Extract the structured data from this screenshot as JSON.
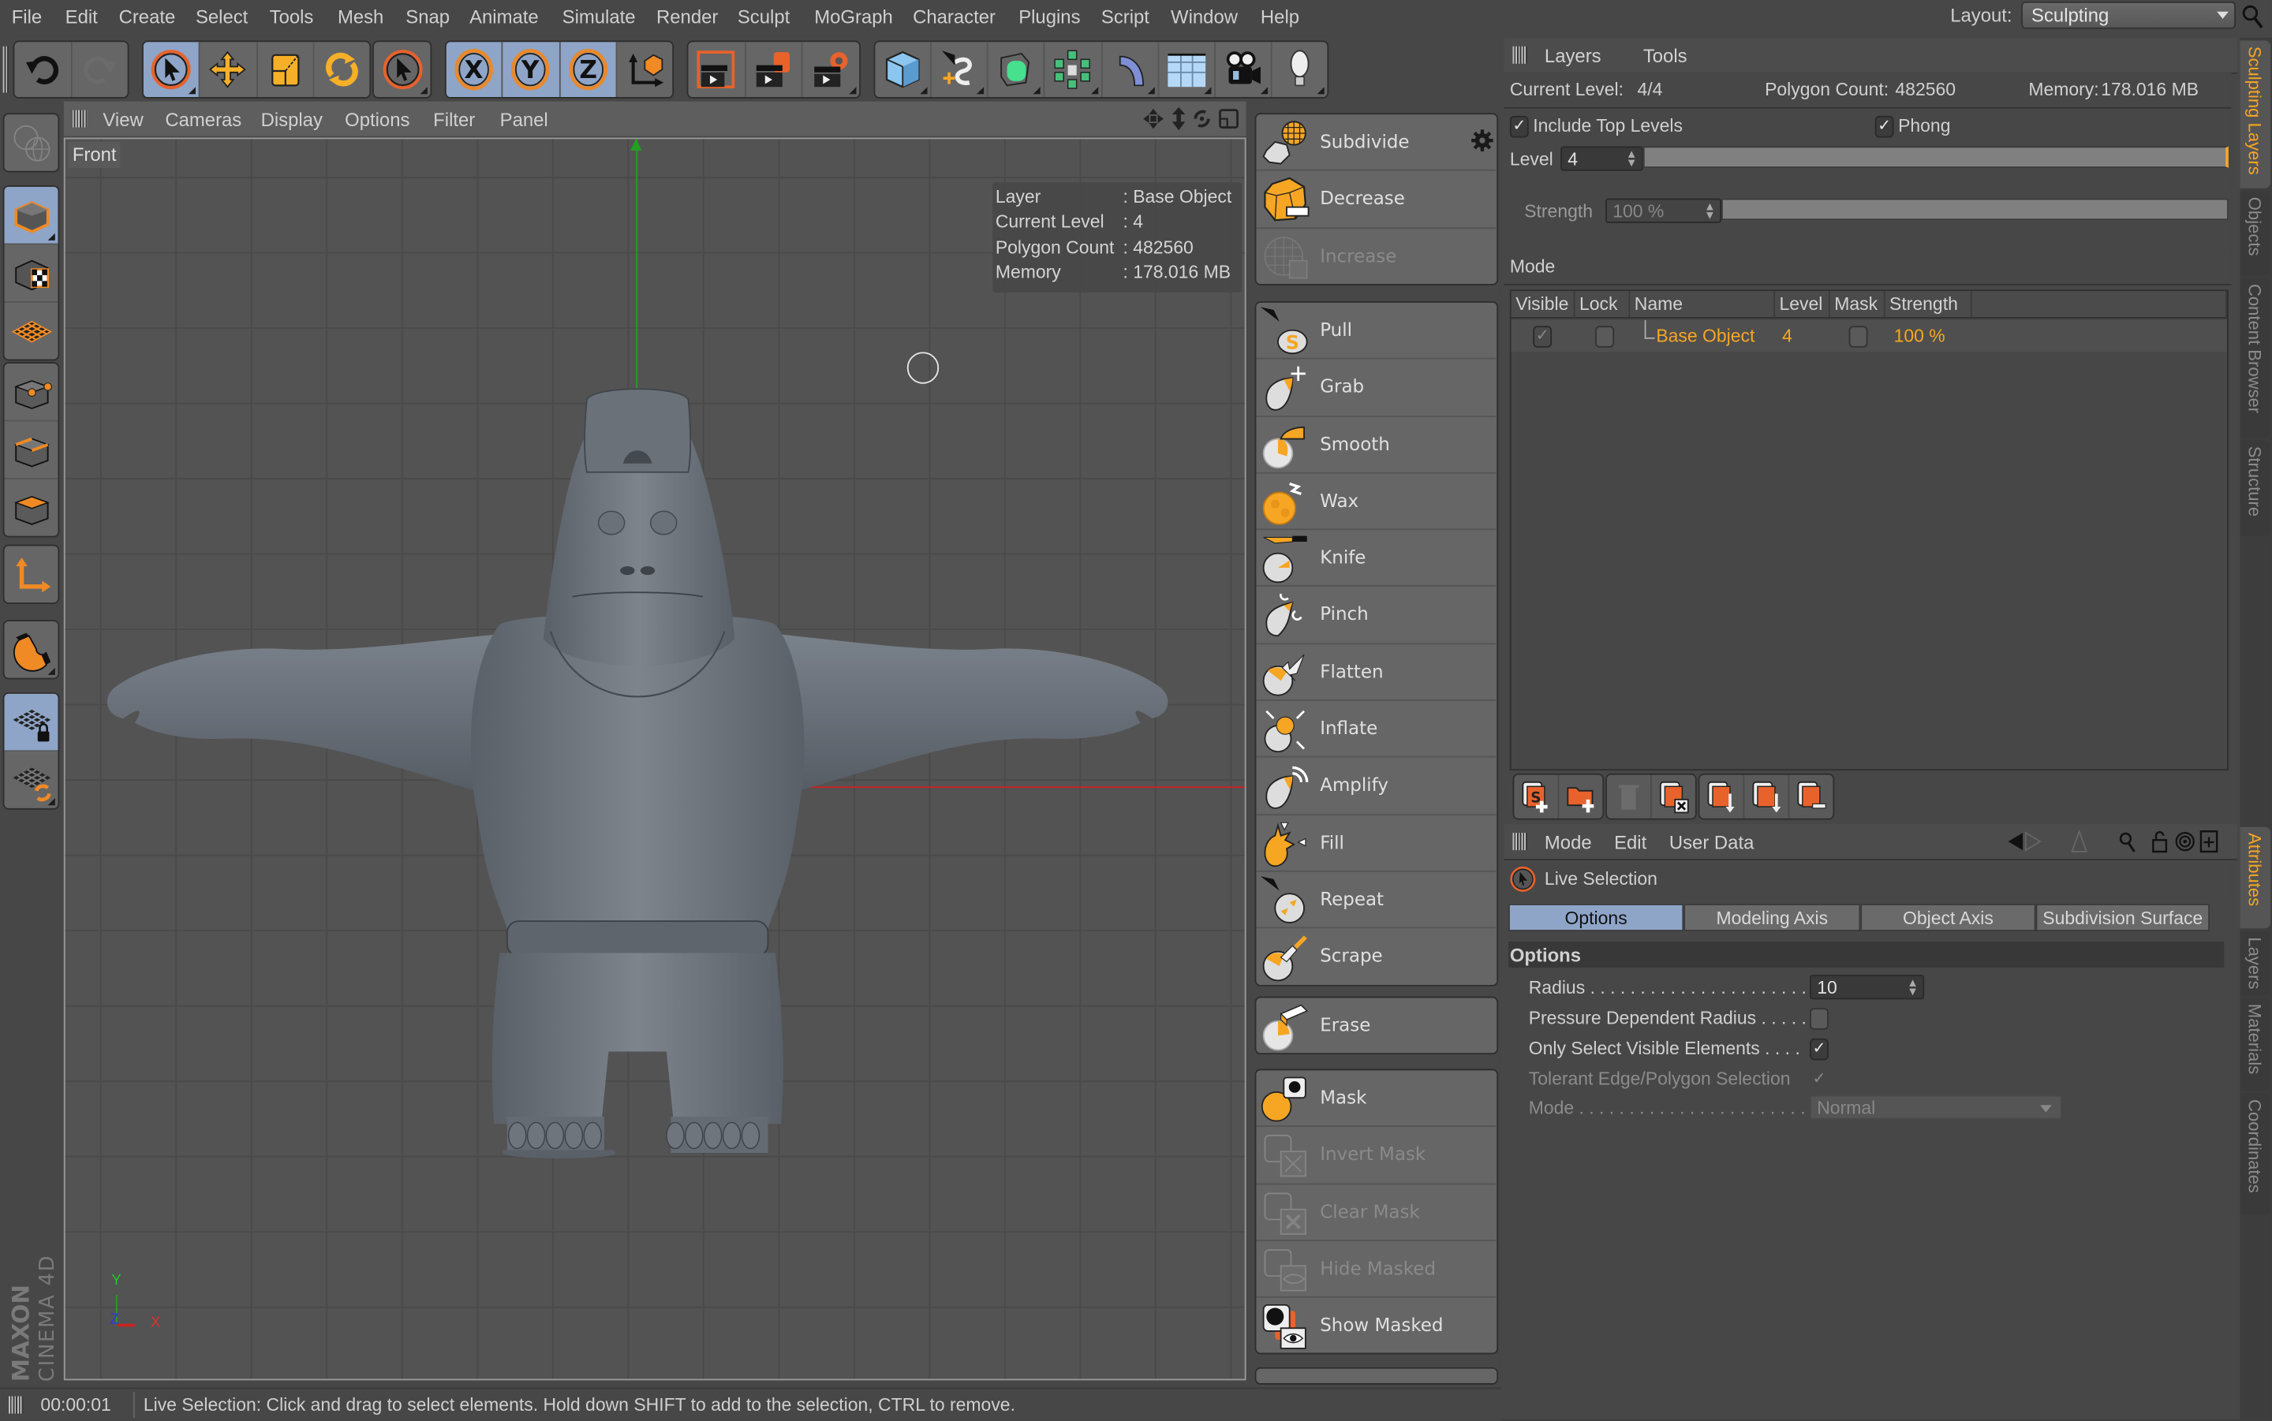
{
  "menubar": {
    "items": [
      "File",
      "Edit",
      "Create",
      "Select",
      "Tools",
      "Mesh",
      "Snap",
      "Animate",
      "Simulate",
      "Render",
      "Sculpt",
      "MoGraph",
      "Character",
      "Plugins",
      "Script",
      "Window",
      "Help"
    ],
    "layout_label": "Layout:",
    "layout_value": "Sculpting"
  },
  "toolbar": {
    "groups": [
      {
        "name": "history",
        "buttons": [
          {
            "icon": "undo-icon",
            "active": false
          },
          {
            "icon": "redo-icon",
            "active": false,
            "disabled": true
          }
        ]
      },
      {
        "name": "transform",
        "buttons": [
          {
            "icon": "live-selection-icon",
            "active": true
          },
          {
            "icon": "move-icon",
            "active": false
          },
          {
            "icon": "scale-icon",
            "active": false
          },
          {
            "icon": "rotate-icon",
            "active": false
          }
        ]
      },
      {
        "name": "selection",
        "buttons": [
          {
            "icon": "selection-cursor-icon",
            "active": false
          }
        ]
      },
      {
        "name": "axis-lock",
        "buttons": [
          {
            "icon": "x-axis-icon",
            "label": "X",
            "active": true
          },
          {
            "icon": "y-axis-icon",
            "label": "Y",
            "active": true
          },
          {
            "icon": "z-axis-icon",
            "label": "Z",
            "active": true
          },
          {
            "icon": "coordinate-system-icon",
            "active": false
          }
        ]
      },
      {
        "name": "render",
        "buttons": [
          {
            "icon": "render-view-icon"
          },
          {
            "icon": "render-picture-viewer-icon"
          },
          {
            "icon": "render-settings-icon"
          }
        ]
      },
      {
        "name": "create",
        "buttons": [
          {
            "icon": "cube-primitive-icon"
          },
          {
            "icon": "spline-pen-icon"
          },
          {
            "icon": "subdivision-surface-icon"
          },
          {
            "icon": "cloner-icon"
          },
          {
            "icon": "bend-deformer-icon"
          },
          {
            "icon": "floor-icon"
          },
          {
            "icon": "camera-icon"
          },
          {
            "icon": "light-icon"
          }
        ]
      }
    ]
  },
  "left_toolbar": {
    "items": [
      "make-editable-icon",
      "model-mode-icon",
      "texture-mode-icon",
      "workplane-mode-icon",
      "points-mode-icon",
      "edges-mode-icon",
      "polygons-mode-icon",
      "axis-mode-icon",
      "magnet-icon",
      "locked-workplane-icon",
      "planar-workplane-icon"
    ],
    "logo_text": [
      "MAXON",
      "CINEMA 4D"
    ]
  },
  "viewport": {
    "menu": [
      "View",
      "Cameras",
      "Display",
      "Options",
      "Filter",
      "Panel"
    ],
    "camera_label": "Front",
    "info": [
      {
        "key": "Layer",
        "value": ": Base Object"
      },
      {
        "key": "Current Level",
        "value": ": 4"
      },
      {
        "key": "Polygon Count",
        "value": ": 482560"
      },
      {
        "key": "Memory",
        "value": ": 178.016 MB"
      }
    ],
    "nav_icons": [
      "pan-icon",
      "zoom-icon",
      "orbit-icon",
      "maximize-view-icon"
    ],
    "axis_labels": {
      "x": "X",
      "y": "Y",
      "z": "Z"
    }
  },
  "sculpt_tools": {
    "groups": [
      [
        {
          "label": "Subdivide",
          "icon": "subdivide-icon",
          "has_settings": true
        },
        {
          "label": "Decrease",
          "icon": "decrease-icon"
        },
        {
          "label": "Increase",
          "icon": "increase-icon",
          "disabled": true
        }
      ],
      [
        {
          "label": "Pull",
          "icon": "pull-brush-icon"
        },
        {
          "label": "Grab",
          "icon": "grab-brush-icon"
        },
        {
          "label": "Smooth",
          "icon": "smooth-brush-icon"
        },
        {
          "label": "Wax",
          "icon": "wax-brush-icon"
        },
        {
          "label": "Knife",
          "icon": "knife-brush-icon"
        },
        {
          "label": "Pinch",
          "icon": "pinch-brush-icon"
        },
        {
          "label": "Flatten",
          "icon": "flatten-brush-icon"
        },
        {
          "label": "Inflate",
          "icon": "inflate-brush-icon"
        },
        {
          "label": "Amplify",
          "icon": "amplify-brush-icon"
        },
        {
          "label": "Fill",
          "icon": "fill-brush-icon"
        },
        {
          "label": "Repeat",
          "icon": "repeat-brush-icon"
        },
        {
          "label": "Scrape",
          "icon": "scrape-brush-icon"
        }
      ],
      [
        {
          "label": "Erase",
          "icon": "erase-brush-icon"
        }
      ],
      [
        {
          "label": "Mask",
          "icon": "mask-brush-icon"
        },
        {
          "label": "Invert Mask",
          "icon": "invert-mask-icon",
          "disabled": true
        },
        {
          "label": "Clear Mask",
          "icon": "clear-mask-icon",
          "disabled": true
        },
        {
          "label": "Hide Masked",
          "icon": "hide-masked-icon",
          "disabled": true
        },
        {
          "label": "Show Masked",
          "icon": "show-masked-icon"
        }
      ]
    ]
  },
  "layers_panel": {
    "menu": [
      "Layers",
      "Tools"
    ],
    "current_level_label": "Current Level:",
    "current_level_value": "4/4",
    "polygon_count_label": "Polygon Count:",
    "polygon_count_value": "482560",
    "memory_label": "Memory:",
    "memory_value": "178.016 MB",
    "include_top_levels": {
      "label": "Include Top Levels",
      "checked": true
    },
    "phong": {
      "label": "Phong",
      "checked": true
    },
    "level": {
      "label": "Level",
      "value": "4",
      "slider_fraction": 1.0
    },
    "strength": {
      "label": "Strength",
      "value": "100 %",
      "slider_fraction": 1.0,
      "disabled": true
    },
    "mode_label": "Mode",
    "table": {
      "columns": [
        "Visible",
        "Lock",
        "Name",
        "Level",
        "Mask",
        "Strength"
      ],
      "rows": [
        {
          "visible": true,
          "lock": false,
          "name": "Base Object",
          "level": "4",
          "mask": false,
          "strength": "100 %"
        }
      ]
    },
    "buttons": [
      "add-layer-icon",
      "add-folder-icon",
      "delete-layer-icon",
      "clear-layer-icon",
      "bake-layer-icon",
      "merge-down-icon",
      "remove-layer-icon"
    ]
  },
  "attributes_panel": {
    "menu": [
      "Mode",
      "Edit",
      "User Data"
    ],
    "header_icons": [
      "back-icon",
      "forward-icon",
      "up-icon",
      "search-icon",
      "lock-icon",
      "target-icon",
      "new-panel-icon"
    ],
    "tool_name": "Live Selection",
    "tabs": [
      {
        "label": "Options",
        "active": true
      },
      {
        "label": "Modeling Axis",
        "active": false
      },
      {
        "label": "Object Axis",
        "active": false
      },
      {
        "label": "Subdivision Surface",
        "active": false
      }
    ],
    "section_title": "Options",
    "fields": [
      {
        "label": "Radius . . . . . . . . . . . . . . . . . . . . . . .",
        "type": "number",
        "value": "10"
      },
      {
        "label": "Pressure Dependent Radius . . . . .",
        "type": "checkbox",
        "checked": false
      },
      {
        "label": "Only Select Visible Elements . . . .",
        "type": "checkbox",
        "checked": true
      },
      {
        "label": "Tolerant Edge/Polygon Selection",
        "type": "checkbox",
        "checked": true,
        "disabled": true
      },
      {
        "label": "Mode . . . . . . . . . . . . . . . . . . . . . . . .",
        "type": "select",
        "value": "Normal",
        "disabled": true
      }
    ]
  },
  "side_tabs_top": [
    {
      "label": "Sculpting Layers",
      "active": true
    },
    {
      "label": "Objects",
      "active": false
    },
    {
      "label": "Content Browser",
      "active": false
    },
    {
      "label": "Structure",
      "active": false
    }
  ],
  "side_tabs_bottom": [
    {
      "label": "Attributes",
      "active": true
    },
    {
      "label": "Layers",
      "active": false
    },
    {
      "label": "Materials",
      "active": false
    },
    {
      "label": "Coordinates",
      "active": false
    }
  ],
  "statusbar": {
    "time": "00:00:01",
    "message": "Live Selection: Click and drag to select elements. Hold down SHIFT to add to the selection, CTRL to remove."
  },
  "colors": {
    "accent_orange": "#f6a623",
    "active_blue": "#8ea5c8",
    "axis_x": "#cc2222",
    "axis_y": "#22aa22",
    "axis_z": "#2244cc"
  }
}
